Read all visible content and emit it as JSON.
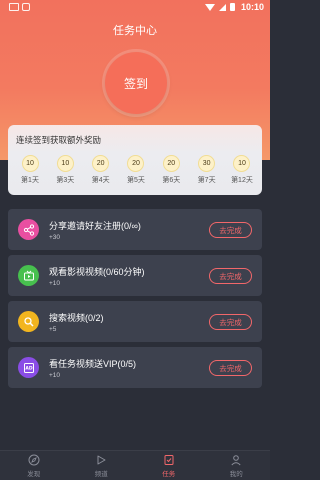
{
  "status_bar": {
    "time": "10:10"
  },
  "header": {
    "title": "任务中心"
  },
  "signin": {
    "label": "签到"
  },
  "streak": {
    "title": "连续签到获取额外奖励",
    "days": [
      {
        "value": "10",
        "label": "第1天"
      },
      {
        "value": "10",
        "label": "第3天"
      },
      {
        "value": "20",
        "label": "第4天"
      },
      {
        "value": "20",
        "label": "第5天"
      },
      {
        "value": "20",
        "label": "第6天"
      },
      {
        "value": "30",
        "label": "第7天"
      },
      {
        "value": "10",
        "label": "第12天"
      }
    ]
  },
  "tasks": [
    {
      "icon": "share-icon",
      "color": "#e94fa1",
      "title": "分享邀请好友注册(0/∞)",
      "reward": "+30",
      "button": "去完成"
    },
    {
      "icon": "tv-icon",
      "color": "#47c04e",
      "title": "观看影视视频(0/60分钟)",
      "reward": "+10",
      "button": "去完成"
    },
    {
      "icon": "search-icon",
      "color": "#f2b51f",
      "title": "搜索视频(0/2)",
      "reward": "+5",
      "button": "去完成"
    },
    {
      "icon": "ad-icon",
      "color": "#8a4de6",
      "title": "看任务视频送VIP(0/5)",
      "reward": "+10",
      "button": "去完成"
    }
  ],
  "tabbar": {
    "items": [
      {
        "label": "发现",
        "icon": "compass-icon"
      },
      {
        "label": "频道",
        "icon": "play-icon"
      },
      {
        "label": "任务",
        "icon": "task-icon",
        "active": true
      },
      {
        "label": "我的",
        "icon": "person-icon"
      }
    ]
  },
  "colors": {
    "accent": "#f2676a",
    "hero_top": "#f2715d",
    "background": "#2b2e38",
    "card": "#3d414e"
  }
}
